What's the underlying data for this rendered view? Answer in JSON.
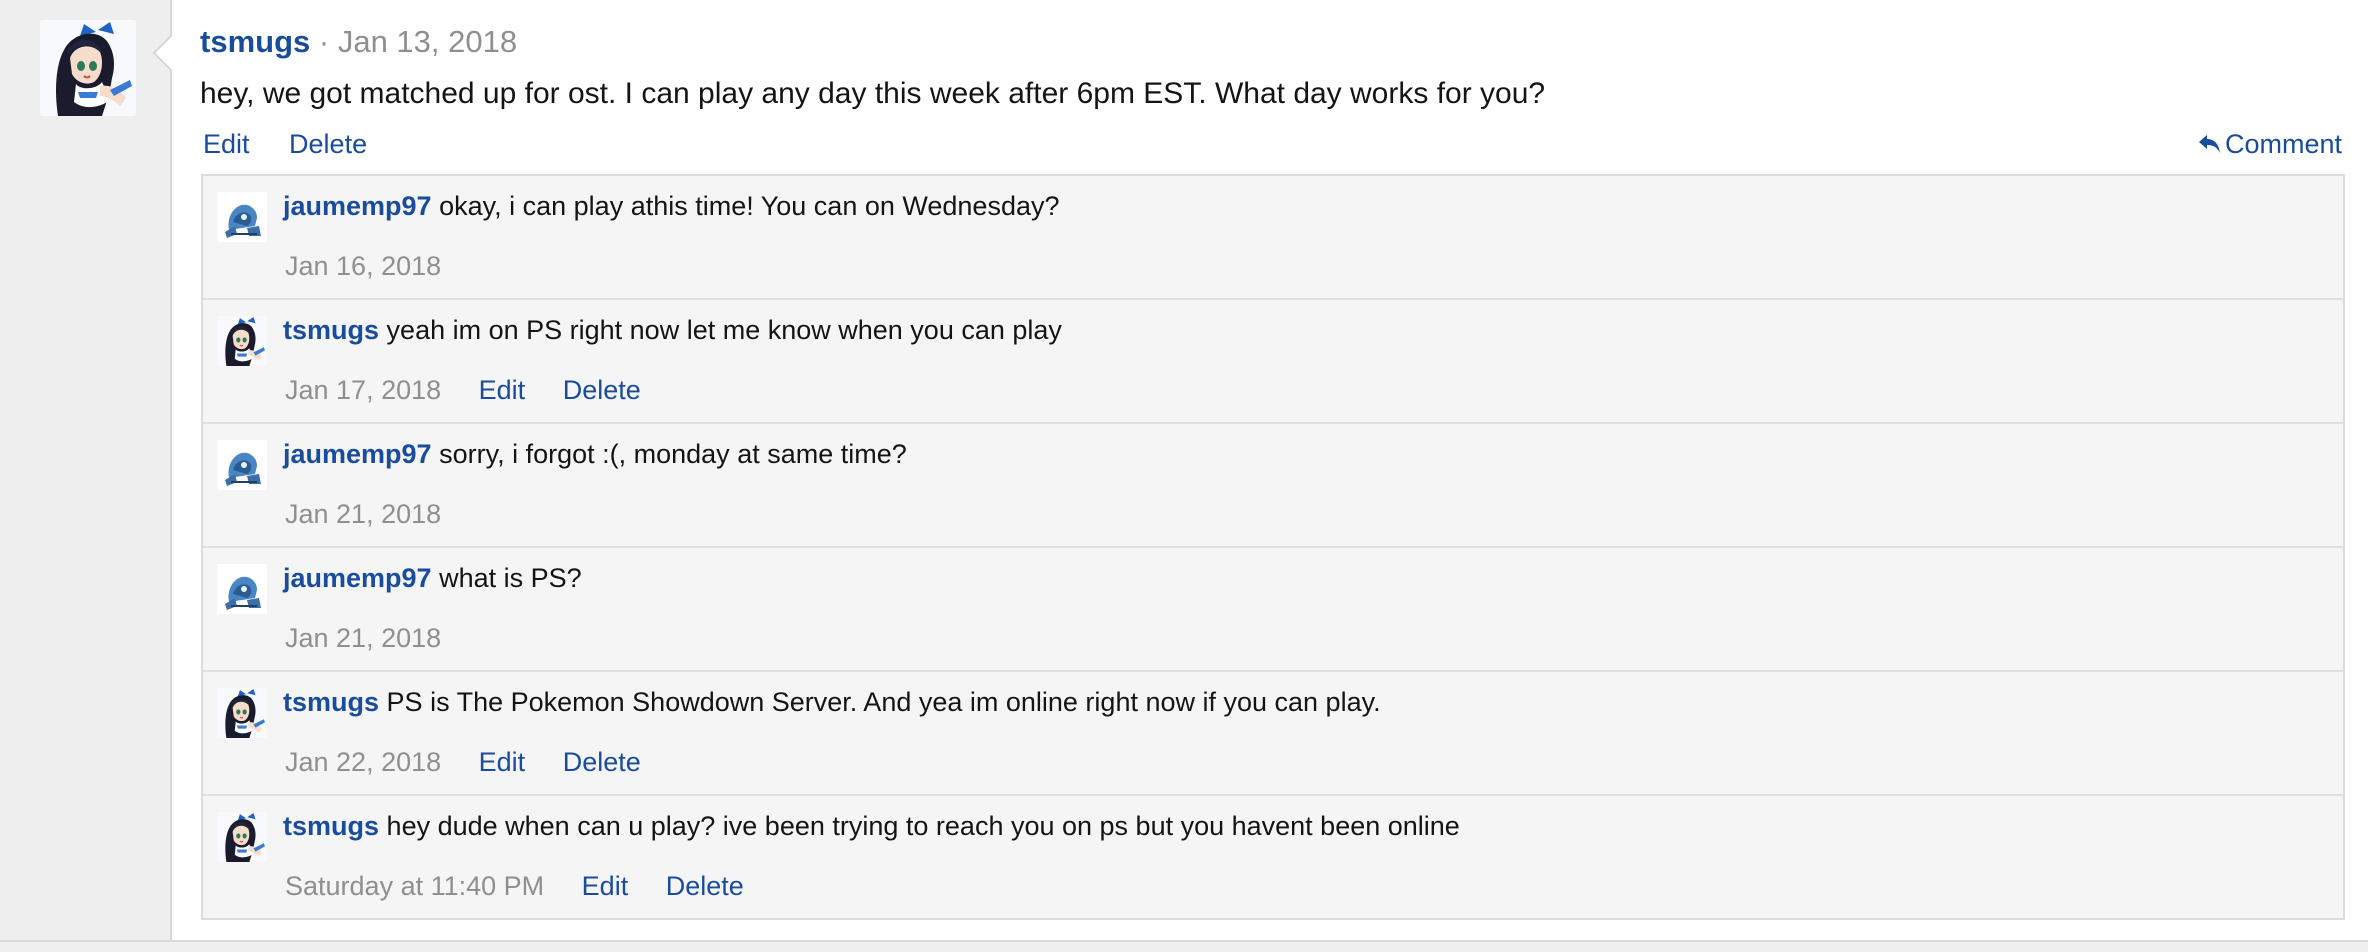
{
  "post": {
    "author": "tsmugs",
    "separator": "·",
    "date": "Jan 13, 2018",
    "text": "hey, we got matched up for ost. I can play any day this week after 6pm EST. What day works for you?",
    "actions": {
      "edit": "Edit",
      "delete": "Delete",
      "comment": "Comment"
    },
    "icons": {
      "reply": "reply-arrow-icon",
      "avatar": "anime-girl-avatar"
    }
  },
  "comments": [
    {
      "author": "jaumemp97",
      "text": "okay, i can play athis time! You can on Wednesday?",
      "date": "Jan 16, 2018",
      "avatar": "robot-avatar"
    },
    {
      "author": "tsmugs",
      "text": "yeah im on PS right now let me know when you can play",
      "date": "Jan 17, 2018",
      "edit": "Edit",
      "delete": "Delete",
      "avatar": "anime-girl-avatar"
    },
    {
      "author": "jaumemp97",
      "text": "sorry, i forgot :(, monday at same time?",
      "date": "Jan 21, 2018",
      "avatar": "robot-avatar"
    },
    {
      "author": "jaumemp97",
      "text": "what is PS?",
      "date": "Jan 21, 2018",
      "avatar": "robot-avatar"
    },
    {
      "author": "tsmugs",
      "text": "PS is The Pokemon Showdown Server. And yea im online right now if you can play.",
      "date": "Jan 22, 2018",
      "edit": "Edit",
      "delete": "Delete",
      "avatar": "anime-girl-avatar"
    },
    {
      "author": "tsmugs",
      "text": "hey dude when can u play? ive been trying to reach you on ps but you havent been online",
      "date": "Saturday at 11:40 PM",
      "edit": "Edit",
      "delete": "Delete",
      "avatar": "anime-girl-avatar"
    }
  ],
  "colors": {
    "link": "#1a4c9e",
    "muted": "#8f8f8f",
    "panel": "#f5f5f5",
    "sidebar": "#eeeeee"
  }
}
